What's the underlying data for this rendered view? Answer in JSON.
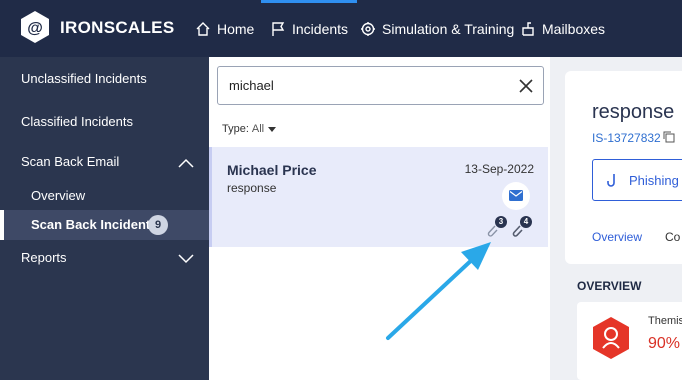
{
  "header": {
    "brand": "IRONSCALES",
    "nav": [
      {
        "label": "Home",
        "icon": "home-icon"
      },
      {
        "label": "Incidents",
        "icon": "flag-icon",
        "active": true
      },
      {
        "label": "Simulation & Training",
        "icon": "gear-icon"
      },
      {
        "label": "Mailboxes",
        "icon": "mailbox-icon"
      }
    ]
  },
  "sidebar": {
    "items": [
      {
        "label": "Unclassified Incidents"
      },
      {
        "label": "Classified Incidents"
      },
      {
        "label": "Scan Back Email",
        "expanded": true
      },
      {
        "label": "Overview"
      },
      {
        "label": "Scan Back Incidents",
        "badge": "9",
        "active": true
      },
      {
        "label": "Reports",
        "expanded": false
      }
    ]
  },
  "list": {
    "search_value": "michael",
    "type_label": "Type:",
    "type_value": "All",
    "incident": {
      "name": "Michael Price",
      "subject": "response",
      "date": "13-Sep-2022",
      "attach_counts": [
        "3",
        "4"
      ]
    }
  },
  "detail": {
    "title": "response",
    "incident_id": "IS-13727832",
    "action_label": "Phishing",
    "tabs": [
      "Overview",
      "Co"
    ],
    "overview_heading": "OVERVIEW",
    "engine_name": "Themis",
    "engine_percent": "90%"
  },
  "colors": {
    "header_bg": "#202b47",
    "sidebar_bg": "#2b364f",
    "accent_blue": "#2f5ed8",
    "selected_card": "#e8ebfa",
    "danger": "#d93025",
    "annotation_arrow": "#2aa8e8"
  }
}
